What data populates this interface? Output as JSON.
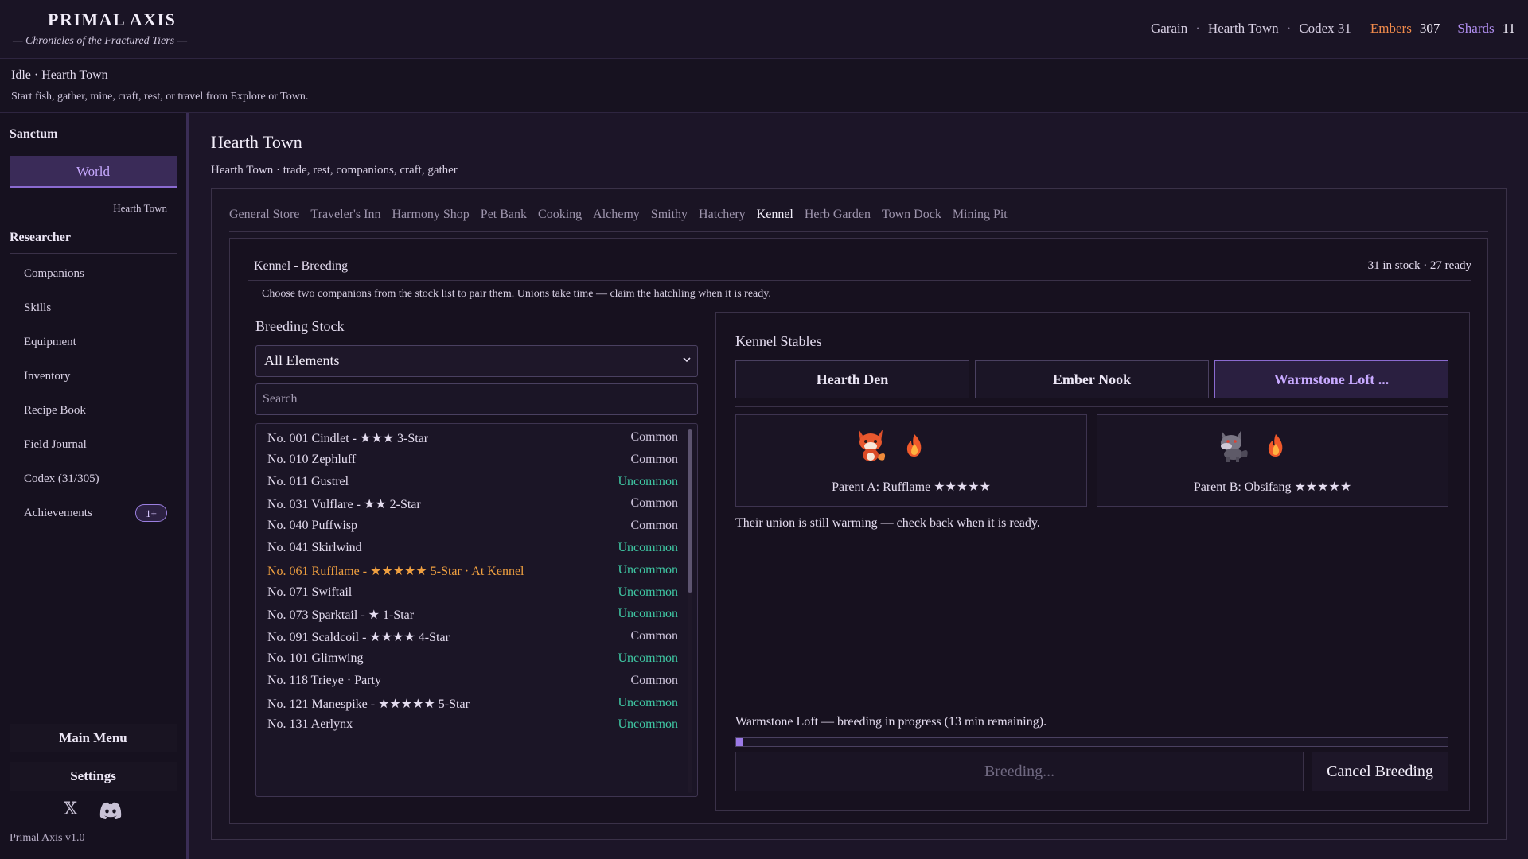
{
  "header": {
    "app_title": "PRIMAL AXIS",
    "app_subtitle": "— Chronicles of the Fractured Tiers —",
    "player": "Garain",
    "location": "Hearth Town",
    "codex": "Codex 31",
    "embers_label": "Embers",
    "embers_value": "307",
    "shards_label": "Shards",
    "shards_value": "11",
    "separator": "·"
  },
  "status": {
    "state": "Idle",
    "location": "Hearth Town",
    "hint": "Start fish, gather, mine, craft, rest, or travel from Explore or Town."
  },
  "sidebar": {
    "sanctum_heading": "Sanctum",
    "world_button": "World",
    "world_sub": "Hearth Town",
    "researcher_heading": "Researcher",
    "items": [
      {
        "label": "Companions"
      },
      {
        "label": "Skills"
      },
      {
        "label": "Equipment"
      },
      {
        "label": "Inventory"
      },
      {
        "label": "Recipe Book"
      },
      {
        "label": "Field Journal"
      },
      {
        "label": "Codex (31/305)"
      },
      {
        "label": "Achievements",
        "badge": "1+"
      }
    ],
    "main_menu": "Main Menu",
    "settings": "Settings",
    "version": "Primal Axis  v1.0",
    "social": {
      "x_icon": "𝕏"
    }
  },
  "main": {
    "title": "Hearth Town",
    "subtitle": "Hearth Town · trade, rest, companions, craft, gather",
    "tabs": [
      "General Store",
      "Traveler's Inn",
      "Harmony Shop",
      "Pet Bank",
      "Cooking",
      "Alchemy",
      "Smithy",
      "Hatchery",
      "Kennel",
      "Herb Garden",
      "Town Dock",
      "Mining Pit"
    ],
    "active_tab": "Kennel"
  },
  "kennel": {
    "title": "Kennel - Breeding",
    "stock_summary": "31 in stock · 27 ready",
    "description": "Choose two companions from the stock list to pair them. Unions take time — claim the hatchling when it is ready.",
    "stock_heading": "Breeding Stock",
    "filter_value": "All Elements",
    "search_placeholder": "Search",
    "stock": [
      {
        "name": "No. 001 Cindlet - ★★★ 3-Star",
        "rarity": "Common"
      },
      {
        "name": "No. 010 Zephluff",
        "rarity": "Common"
      },
      {
        "name": "No. 011 Gustrel",
        "rarity": "Uncommon"
      },
      {
        "name": "No. 031 Vulflare - ★★ 2-Star",
        "rarity": "Common"
      },
      {
        "name": "No. 040 Puffwisp",
        "rarity": "Common"
      },
      {
        "name": "No. 041 Skirlwind",
        "rarity": "Uncommon"
      },
      {
        "name": "No. 061 Rufflame - ★★★★★ 5-Star · At Kennel",
        "rarity": "Uncommon",
        "at_kennel": true
      },
      {
        "name": "No. 071 Swiftail",
        "rarity": "Uncommon"
      },
      {
        "name": "No. 073 Sparktail - ★ 1-Star",
        "rarity": "Uncommon"
      },
      {
        "name": "No. 091 Scaldcoil - ★★★★ 4-Star",
        "rarity": "Common"
      },
      {
        "name": "No. 101 Glimwing",
        "rarity": "Uncommon"
      },
      {
        "name": "No. 118 Trieye · Party",
        "rarity": "Common"
      },
      {
        "name": "No. 121 Manespike - ★★★★★ 5-Star",
        "rarity": "Uncommon"
      },
      {
        "name": "No. 131 Aerlynx",
        "rarity": "Uncommon"
      }
    ],
    "scroll_fraction": 0.45
  },
  "stables": {
    "heading": "Kennel Stables",
    "buttons": [
      "Hearth Den",
      "Ember Nook",
      "Warmstone Loft ..."
    ],
    "active": "Warmstone Loft ...",
    "parent_a": {
      "label": "Parent A: Rufflame ★★★★★",
      "sprite": "fox-creature-icon",
      "element": "fire-element-icon"
    },
    "parent_b": {
      "label": "Parent B: Obsifang ★★★★★",
      "sprite": "wolf-creature-icon",
      "element": "fire-element-icon"
    },
    "union_note": "Their union is still warming — check back when it is ready.",
    "progress_text": "Warmstone Loft — breeding in progress (13 min remaining).",
    "progress_fraction": 0.01,
    "breeding_label": "Breeding...",
    "cancel_label": "Cancel Breeding"
  },
  "colors": {
    "accent": "#9c7ae8",
    "embers": "#f08a4b",
    "shards": "#b08ef0",
    "uncommon": "#3fc7a3",
    "at_kennel": "#f0a040"
  }
}
